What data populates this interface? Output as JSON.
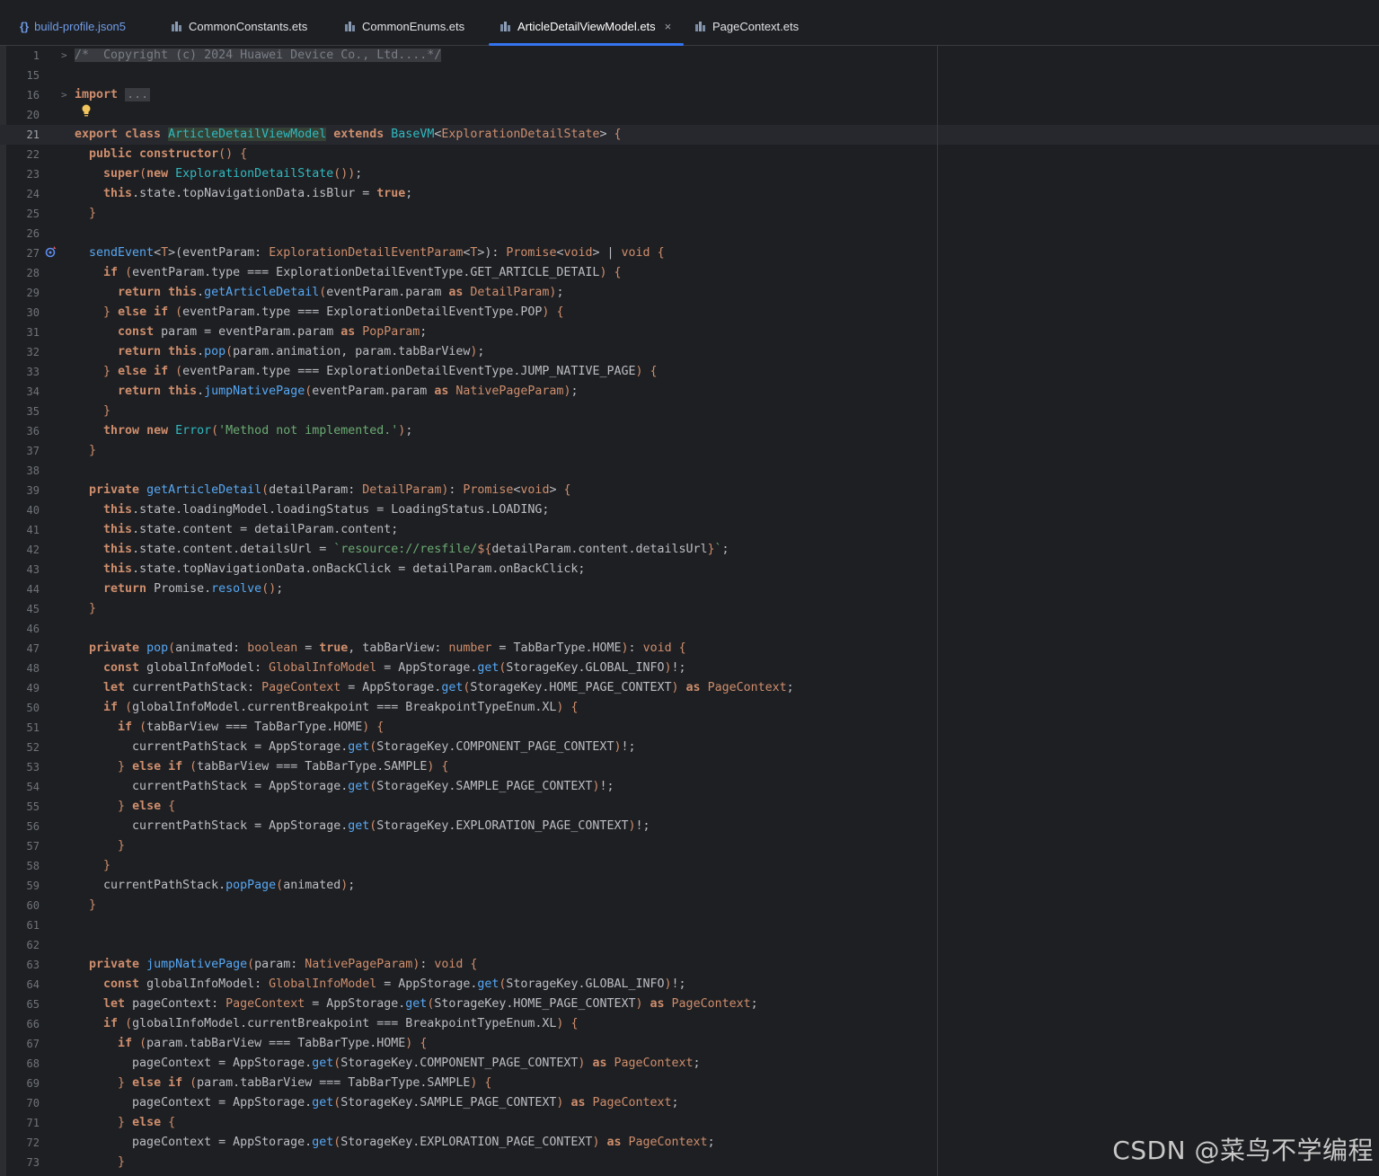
{
  "tabs": [
    {
      "label": "build-profile.json5",
      "icon": "json-file-icon",
      "active": false
    },
    {
      "label": "CommonConstants.ets",
      "icon": "ets-file-icon",
      "active": false
    },
    {
      "label": "CommonEnums.ets",
      "icon": "ets-file-icon",
      "active": false
    },
    {
      "label": "ArticleDetailViewModel.ets",
      "icon": "ets-file-icon",
      "active": true,
      "close": "×"
    },
    {
      "label": "PageContext.ets",
      "icon": "ets-file-icon",
      "active": false
    }
  ],
  "watermark": "CSDN @菜鸟不学编程",
  "current_line": "21",
  "code_lines": [
    {
      "n": "1",
      "html": "<span class=\"hl comment\">/*  Copyright (c) 2024 Huawei Device Co., Ltd....*/</span>",
      "fold": ">"
    },
    {
      "n": "15",
      "html": ""
    },
    {
      "n": "16",
      "html": "<span class=\"kw\">import</span> <span class=\"fold-box\">...</span>",
      "fold": ">"
    },
    {
      "n": "20",
      "html": ""
    },
    {
      "n": "21",
      "html": "<span class=\"kw\">export class</span> <span class=\"ty cls-hl\">ArticleDetailViewModel</span> <span class=\"kw\">extends</span> <span class=\"ty\">BaseVM</span>&lt;<span class=\"t\">ExplorationDetailState</span>&gt; <span class=\"k\">{</span>"
    },
    {
      "n": "22",
      "html": "  <span class=\"kw\">public constructor</span><span class=\"k\">()</span> <span class=\"k\">{</span>"
    },
    {
      "n": "23",
      "html": "    <span class=\"kw\">super</span><span class=\"k\">(</span><span class=\"kw\">new</span> <span class=\"ty\">ExplorationDetailState</span><span class=\"k\">())</span>;"
    },
    {
      "n": "24",
      "html": "    <span class=\"kw\">this</span>.state.topNavigationData.isBlur = <span class=\"kw\">true</span>;"
    },
    {
      "n": "25",
      "html": "  <span class=\"k\">}</span>"
    },
    {
      "n": "26",
      "html": ""
    },
    {
      "n": "27",
      "html": "  <span class=\"f\">sendEvent</span>&lt;<span class=\"t\">T</span>&gt;(eventParam: <span class=\"t\">ExplorationDetailEventParam</span>&lt;<span class=\"t\">T</span>&gt;): <span class=\"t\">Promise</span>&lt;<span class=\"k\">void</span>&gt; | <span class=\"k\">void</span> <span class=\"k\">{</span>"
    },
    {
      "n": "28",
      "html": "    <span class=\"kw\">if</span> <span class=\"k\">(</span>eventParam.type === ExplorationDetailEventType.GET_ARTICLE_DETAIL<span class=\"k\">)</span> <span class=\"k\">{</span>"
    },
    {
      "n": "29",
      "html": "      <span class=\"kw\">return this</span>.<span class=\"f\">getArticleDetail</span><span class=\"k\">(</span>eventParam.param <span class=\"kw\">as</span> <span class=\"t\">DetailParam</span><span class=\"k\">)</span>;"
    },
    {
      "n": "30",
      "html": "    <span class=\"k\">}</span> <span class=\"kw\">else if</span> <span class=\"k\">(</span>eventParam.type === ExplorationDetailEventType.POP<span class=\"k\">)</span> <span class=\"k\">{</span>"
    },
    {
      "n": "31",
      "html": "      <span class=\"kw\">const</span> param = eventParam.param <span class=\"kw\">as</span> <span class=\"t\">PopParam</span>;"
    },
    {
      "n": "32",
      "html": "      <span class=\"kw\">return this</span>.<span class=\"f\">pop</span><span class=\"k\">(</span>param.animation, param.tabBarView<span class=\"k\">)</span>;"
    },
    {
      "n": "33",
      "html": "    <span class=\"k\">}</span> <span class=\"kw\">else if</span> <span class=\"k\">(</span>eventParam.type === ExplorationDetailEventType.JUMP_NATIVE_PAGE<span class=\"k\">)</span> <span class=\"k\">{</span>"
    },
    {
      "n": "34",
      "html": "      <span class=\"kw\">return this</span>.<span class=\"f\">jumpNativePage</span><span class=\"k\">(</span>eventParam.param <span class=\"kw\">as</span> <span class=\"t\">NativePageParam</span><span class=\"k\">)</span>;"
    },
    {
      "n": "35",
      "html": "    <span class=\"k\">}</span>"
    },
    {
      "n": "36",
      "html": "    <span class=\"kw\">throw new</span> <span class=\"ty\">Error</span><span class=\"k\">(</span><span class=\"s\">'Method not implemented.'</span><span class=\"k\">)</span>;"
    },
    {
      "n": "37",
      "html": "  <span class=\"k\">}</span>"
    },
    {
      "n": "38",
      "html": ""
    },
    {
      "n": "39",
      "html": "  <span class=\"kw\">private</span> <span class=\"f\">getArticleDetail</span><span class=\"k\">(</span>detailParam: <span class=\"t\">DetailParam</span><span class=\"k\">)</span>: <span class=\"t\">Promise</span>&lt;<span class=\"k\">void</span>&gt; <span class=\"k\">{</span>"
    },
    {
      "n": "40",
      "html": "    <span class=\"kw\">this</span>.state.loadingModel.loadingStatus = LoadingStatus.LOADING;"
    },
    {
      "n": "41",
      "html": "    <span class=\"kw\">this</span>.state.content = detailParam.content;"
    },
    {
      "n": "42",
      "html": "    <span class=\"kw\">this</span>.state.content.detailsUrl = <span class=\"s\">`resource://resfile/</span><span class=\"k\">${</span>detailParam.content.detailsUrl<span class=\"k\">}</span><span class=\"s\">`</span>;"
    },
    {
      "n": "43",
      "html": "    <span class=\"kw\">this</span>.state.topNavigationData.onBackClick = detailParam.onBackClick;"
    },
    {
      "n": "44",
      "html": "    <span class=\"kw\">return</span> Promise.<span class=\"f\">resolve</span><span class=\"k\">()</span>;"
    },
    {
      "n": "45",
      "html": "  <span class=\"k\">}</span>"
    },
    {
      "n": "46",
      "html": ""
    },
    {
      "n": "47",
      "html": "  <span class=\"kw\">private</span> <span class=\"f\">pop</span><span class=\"k\">(</span>animated: <span class=\"t\">boolean</span> = <span class=\"kw\">true</span>, tabBarView: <span class=\"t\">number</span> = TabBarType.HOME<span class=\"k\">)</span>: <span class=\"k\">void</span> <span class=\"k\">{</span>"
    },
    {
      "n": "48",
      "html": "    <span class=\"kw\">const</span> globalInfoModel: <span class=\"t\">GlobalInfoModel</span> = AppStorage.<span class=\"f\">get</span><span class=\"k\">(</span>StorageKey.GLOBAL_INFO<span class=\"k\">)</span>!;"
    },
    {
      "n": "49",
      "html": "    <span class=\"kw\">let</span> currentPathStack: <span class=\"t\">PageContext</span> = AppStorage.<span class=\"f\">get</span><span class=\"k\">(</span>StorageKey.HOME_PAGE_CONTEXT<span class=\"k\">)</span> <span class=\"kw\">as</span> <span class=\"t\">PageContext</span>;"
    },
    {
      "n": "50",
      "html": "    <span class=\"kw\">if</span> <span class=\"k\">(</span>globalInfoModel.currentBreakpoint === BreakpointTypeEnum.XL<span class=\"k\">)</span> <span class=\"k\">{</span>"
    },
    {
      "n": "51",
      "html": "      <span class=\"kw\">if</span> <span class=\"k\">(</span>tabBarView === TabBarType.HOME<span class=\"k\">)</span> <span class=\"k\">{</span>"
    },
    {
      "n": "52",
      "html": "        currentPathStack = AppStorage.<span class=\"f\">get</span><span class=\"k\">(</span>StorageKey.COMPONENT_PAGE_CONTEXT<span class=\"k\">)</span>!;"
    },
    {
      "n": "53",
      "html": "      <span class=\"k\">}</span> <span class=\"kw\">else if</span> <span class=\"k\">(</span>tabBarView === TabBarType.SAMPLE<span class=\"k\">)</span> <span class=\"k\">{</span>"
    },
    {
      "n": "54",
      "html": "        currentPathStack = AppStorage.<span class=\"f\">get</span><span class=\"k\">(</span>StorageKey.SAMPLE_PAGE_CONTEXT<span class=\"k\">)</span>!;"
    },
    {
      "n": "55",
      "html": "      <span class=\"k\">}</span> <span class=\"kw\">else</span> <span class=\"k\">{</span>"
    },
    {
      "n": "56",
      "html": "        currentPathStack = AppStorage.<span class=\"f\">get</span><span class=\"k\">(</span>StorageKey.EXPLORATION_PAGE_CONTEXT<span class=\"k\">)</span>!;"
    },
    {
      "n": "57",
      "html": "      <span class=\"k\">}</span>"
    },
    {
      "n": "58",
      "html": "    <span class=\"k\">}</span>"
    },
    {
      "n": "59",
      "html": "    currentPathStack.<span class=\"f\">popPage</span><span class=\"k\">(</span>animated<span class=\"k\">)</span>;"
    },
    {
      "n": "60",
      "html": "  <span class=\"k\">}</span>"
    },
    {
      "n": "61",
      "html": ""
    },
    {
      "n": "62",
      "html": ""
    },
    {
      "n": "63",
      "html": "  <span class=\"kw\">private</span> <span class=\"f\">jumpNativePage</span><span class=\"k\">(</span>param: <span class=\"t\">NativePageParam</span><span class=\"k\">)</span>: <span class=\"k\">void</span> <span class=\"k\">{</span>"
    },
    {
      "n": "64",
      "html": "    <span class=\"kw\">const</span> globalInfoModel: <span class=\"t\">GlobalInfoModel</span> = AppStorage.<span class=\"f\">get</span><span class=\"k\">(</span>StorageKey.GLOBAL_INFO<span class=\"k\">)</span>!;"
    },
    {
      "n": "65",
      "html": "    <span class=\"kw\">let</span> pageContext: <span class=\"t\">PageContext</span> = AppStorage.<span class=\"f\">get</span><span class=\"k\">(</span>StorageKey.HOME_PAGE_CONTEXT<span class=\"k\">)</span> <span class=\"kw\">as</span> <span class=\"t\">PageContext</span>;"
    },
    {
      "n": "66",
      "html": "    <span class=\"kw\">if</span> <span class=\"k\">(</span>globalInfoModel.currentBreakpoint === BreakpointTypeEnum.XL<span class=\"k\">)</span> <span class=\"k\">{</span>"
    },
    {
      "n": "67",
      "html": "      <span class=\"kw\">if</span> <span class=\"k\">(</span>param.tabBarView === TabBarType.HOME<span class=\"k\">)</span> <span class=\"k\">{</span>"
    },
    {
      "n": "68",
      "html": "        pageContext = AppStorage.<span class=\"f\">get</span><span class=\"k\">(</span>StorageKey.COMPONENT_PAGE_CONTEXT<span class=\"k\">)</span> <span class=\"kw\">as</span> <span class=\"t\">PageContext</span>;"
    },
    {
      "n": "69",
      "html": "      <span class=\"k\">}</span> <span class=\"kw\">else if</span> <span class=\"k\">(</span>param.tabBarView === TabBarType.SAMPLE<span class=\"k\">)</span> <span class=\"k\">{</span>"
    },
    {
      "n": "70",
      "html": "        pageContext = AppStorage.<span class=\"f\">get</span><span class=\"k\">(</span>StorageKey.SAMPLE_PAGE_CONTEXT<span class=\"k\">)</span> <span class=\"kw\">as</span> <span class=\"t\">PageContext</span>;"
    },
    {
      "n": "71",
      "html": "      <span class=\"k\">}</span> <span class=\"kw\">else</span> <span class=\"k\">{</span>"
    },
    {
      "n": "72",
      "html": "        pageContext = AppStorage.<span class=\"f\">get</span><span class=\"k\">(</span>StorageKey.EXPLORATION_PAGE_CONTEXT<span class=\"k\">)</span> <span class=\"kw\">as</span> <span class=\"t\">PageContext</span>;"
    },
    {
      "n": "73",
      "html": "      <span class=\"k\">}</span>"
    }
  ]
}
